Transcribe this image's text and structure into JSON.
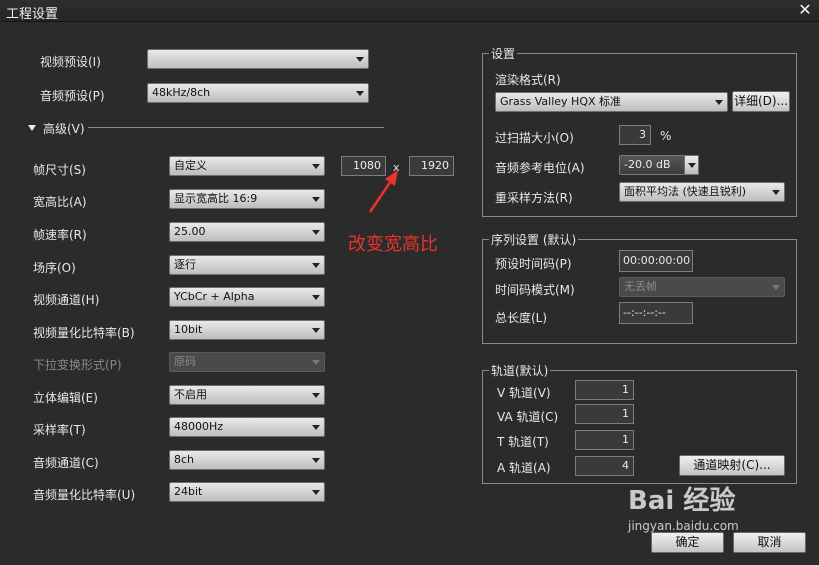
{
  "window": {
    "title": "工程设置",
    "close_glyph": "✕"
  },
  "left": {
    "video_preset_label": "视频预设(I)",
    "video_preset_value": "",
    "audio_preset_label": "音频预设(P)",
    "audio_preset_value": "48kHz/8ch",
    "advanced_label": "高级(V)",
    "frame_size_label": "帧尺寸(S)",
    "frame_size_value": "自定义",
    "frame_width": "1080",
    "frame_x": "x",
    "frame_height": "1920",
    "aspect_label": "宽高比(A)",
    "aspect_value": "显示宽高比 16:9",
    "frame_rate_label": "帧速率(R)",
    "frame_rate_value": "25.00",
    "field_order_label": "场序(O)",
    "field_order_value": "逐行",
    "video_channel_label": "视频通道(H)",
    "video_channel_value": "YCbCr + Alpha",
    "video_quant_label": "视频量化比特率(B)",
    "video_quant_value": "10bit",
    "pulldown_label": "下拉变换形式(P)",
    "pulldown_value": "原码",
    "stereo_label": "立体编辑(E)",
    "stereo_value": "不启用",
    "sample_rate_label": "采样率(T)",
    "sample_rate_value": "48000Hz",
    "audio_channel_label": "音频通道(C)",
    "audio_channel_value": "8ch",
    "audio_quant_label": "音频量化比特率(U)",
    "audio_quant_value": "24bit"
  },
  "annotation": "改变宽高比",
  "settings": {
    "group_title": "设置",
    "render_format_label": "渲染格式(R)",
    "render_format_value": "Grass Valley HQX 标准",
    "detail_button": "详细(D)...",
    "overscan_label": "过扫描大小(O)",
    "overscan_value": "3",
    "overscan_unit": "%",
    "audio_ref_label": "音频参考电位(A)",
    "audio_ref_value": "-20.0 dB",
    "resample_label": "重采样方法(R)",
    "resample_value": "面积平均法 (快速且锐利)"
  },
  "sequence": {
    "group_title": "序列设置 (默认)",
    "timecode_label": "预设时间码(P)",
    "timecode_value": "00:00:00:00",
    "tc_mode_label": "时间码模式(M)",
    "tc_mode_value": "无丢帧",
    "duration_label": "总长度(L)",
    "duration_value": "--:--:--:--"
  },
  "tracks": {
    "group_title": "轨道(默认)",
    "v_label": "V 轨道(V)",
    "v_value": "1",
    "va_label": "VA 轨道(C)",
    "va_value": "1",
    "t_label": "T 轨道(T)",
    "t_value": "1",
    "a_label": "A 轨道(A)",
    "a_value": "4",
    "mapping_button": "通道映射(C)..."
  },
  "footer": {
    "ok_button": "确定",
    "cancel_button": "取消"
  },
  "watermark": {
    "line1": "Bai 经验",
    "line2": "jingyan.baidu.com"
  }
}
